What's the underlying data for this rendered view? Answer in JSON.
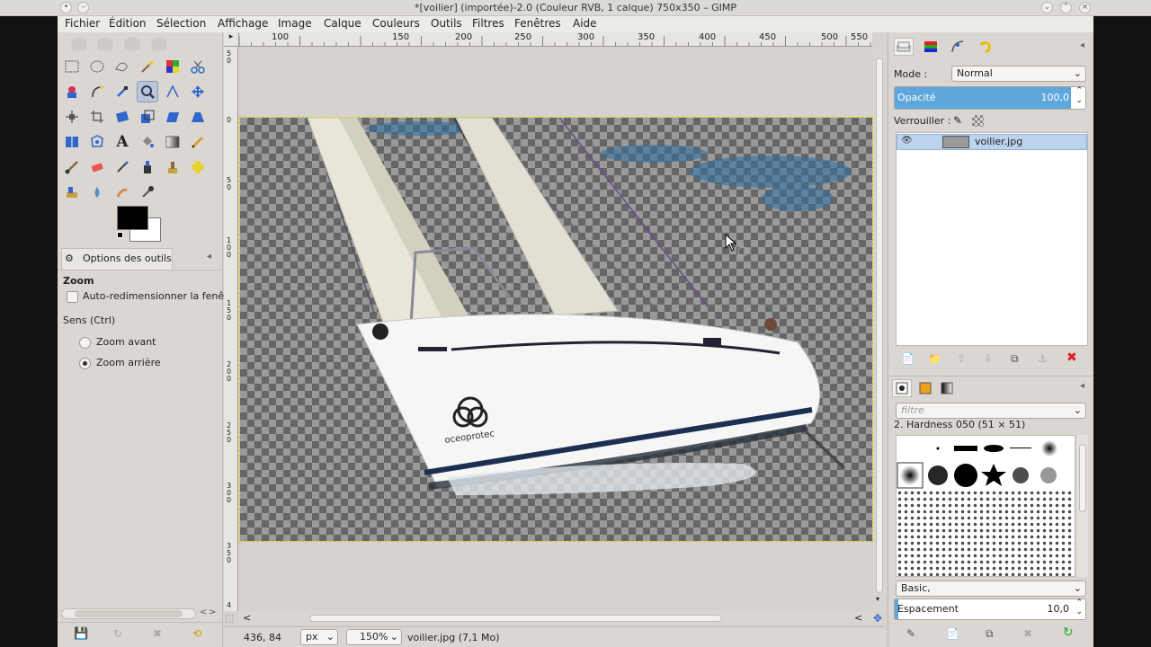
{
  "window": {
    "title": "*[voilier] (importée)-2.0 (Couleur RVB, 1 calque) 750x350 – GIMP"
  },
  "menu": [
    "Fichier",
    "Édition",
    "Sélection",
    "Affichage",
    "Image",
    "Calque",
    "Couleurs",
    "Outils",
    "Filtres",
    "Fenêtres",
    "Aide"
  ],
  "toolbox": {
    "options_tab": "Options des outils",
    "tool_name": "Zoom",
    "auto_resize": "Auto-redimensionner la fenêt",
    "direction_label": "Sens (Ctrl)",
    "zoom_in": "Zoom avant",
    "zoom_out": "Zoom arrière",
    "zoom_out_selected": true
  },
  "rulers": {
    "h_ticks": [
      "100",
      "150",
      "200",
      "250",
      "300",
      "350",
      "400",
      "450",
      "500",
      "550"
    ],
    "v_ticks": [
      "5\n0",
      "0",
      "5\n0",
      "1\n0\n0",
      "1\n5\n0",
      "2\n0\n0",
      "2\n5\n0",
      "3\n0\n0",
      "3\n5\n0",
      "4"
    ]
  },
  "status": {
    "coords": "436, 84",
    "unit": "px",
    "zoom": "150%",
    "file_info": "voilier.jpg (7,1 Mo)"
  },
  "layers": {
    "mode_label": "Mode :",
    "mode_value": "Normal",
    "opacity_label": "Opacité",
    "opacity_value": "100,0",
    "opacity": 1.0,
    "lock_label": "Verrouiller :",
    "layer_name": "voilier.jpg"
  },
  "brushes": {
    "filter_placeholder": "filtre",
    "brush_name": "2. Hardness 050 (51 × 51)",
    "tag_value": "Basic,",
    "spacing_label": "Espacement",
    "spacing_value": "10,0",
    "spacing": 0.1
  },
  "image": {
    "logo_text": "oceoprotec"
  },
  "colors": {
    "foreground": "#000000",
    "background": "#ffffff",
    "accent": "#5ea7dc",
    "selection": "#bcd3ee"
  }
}
